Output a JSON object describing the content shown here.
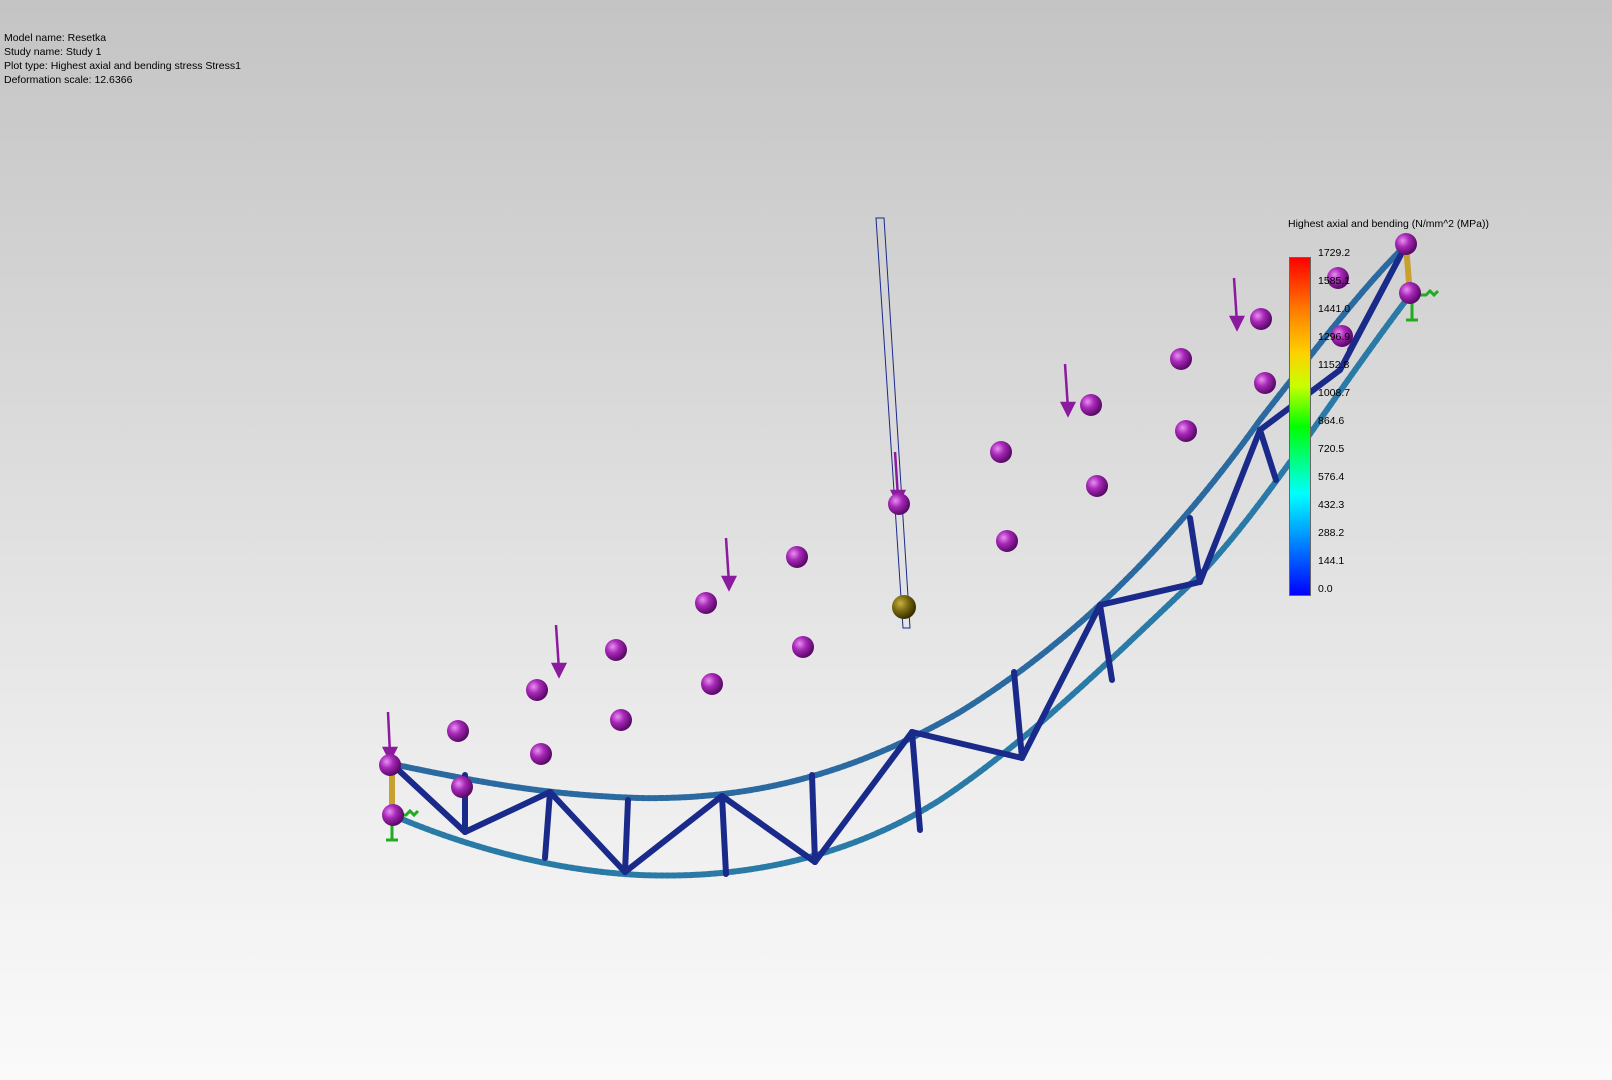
{
  "info": {
    "model_name": "Model name: Resetka",
    "study_name": "Study name: Study 1",
    "plot_type": "Plot type: Highest axial and bending stress Stress1",
    "deformation_scale": "Deformation scale: 12.6366"
  },
  "legend": {
    "title": "Highest axial and bending (N/mm^2 (MPa))",
    "ticks": [
      "1729.2",
      "1585.1",
      "1441.0",
      "1296.9",
      "1152.8",
      "1008.7",
      "864.6",
      "720.5",
      "576.4",
      "432.3",
      "288.2",
      "144.1",
      "0.0"
    ]
  },
  "colors": {
    "truss_member": "#1a2a8a",
    "chord_stress_low": "#2a7aa8",
    "load_marker": "#8b1a9e",
    "fixture": "#22aa22",
    "selected_node": "#6b5a10"
  }
}
